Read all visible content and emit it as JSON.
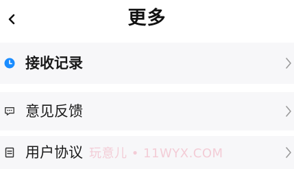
{
  "header": {
    "title": "更多",
    "back_icon": "chevron-left-icon"
  },
  "menu": {
    "items": [
      {
        "label": "接收记录",
        "icon": "clock-icon",
        "icon_color": "#1a8cff",
        "chevron": "chevron-right-icon"
      },
      {
        "label": "意见反馈",
        "icon": "message-icon",
        "icon_color": "#333333",
        "chevron": "chevron-right-icon"
      },
      {
        "label": "用户协议",
        "icon": "document-icon",
        "icon_color": "#333333",
        "chevron": "chevron-right-icon"
      }
    ]
  },
  "watermark": "玩意儿 • 11WYX.COM"
}
